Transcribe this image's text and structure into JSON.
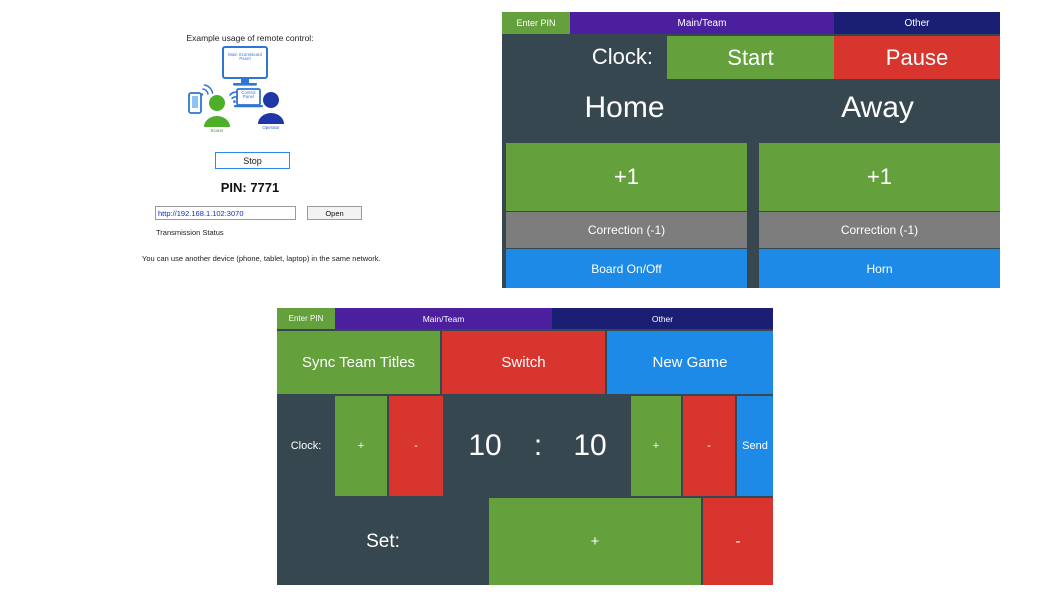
{
  "left_panel": {
    "caption": "Example usage of remote control:",
    "diagram": {
      "main_panel_label": "Main ScoreBoard Panel",
      "control_panel_label": "Control Panel",
      "scorer_label": "Scorer",
      "operator_label": "Operator"
    },
    "stop_button": "Stop",
    "pin_text": "PIN: 7771",
    "url_value": "http://192.168.1.102:3070",
    "url_placeholder": "http://",
    "open_button": "Open",
    "transmission_status": "Transmission Status",
    "note": "You can use another device (phone, tablet, laptop) in the same network."
  },
  "panel_main": {
    "tabs": [
      {
        "label": "Enter PIN",
        "color": "#64a03c"
      },
      {
        "label": "Main/Team",
        "color": "#4b1f9e"
      },
      {
        "label": "Other",
        "color": "#1b1f74"
      }
    ],
    "clock_label": "Clock:",
    "start_button": "Start",
    "pause_button": "Pause",
    "home_label": "Home",
    "away_label": "Away",
    "home_plus": "+1",
    "away_plus": "+1",
    "home_correction": "Correction (-1)",
    "away_correction": "Correction (-1)",
    "board_on_off": "Board On/Off",
    "horn": "Horn"
  },
  "panel_other": {
    "tabs": [
      {
        "label": "Enter PIN",
        "color": "#64a03c"
      },
      {
        "label": "Main/Team",
        "color": "#4b1f9e"
      },
      {
        "label": "Other",
        "color": "#1b1f74"
      }
    ],
    "sync_team_titles": "Sync Team Titles",
    "switch_button": "Switch",
    "new_game_button": "New Game",
    "clock_label": "Clock:",
    "minutes_plus": "+",
    "minutes_minus": "-",
    "minutes_value": "10",
    "colon": ":",
    "seconds_value": "10",
    "seconds_plus": "+",
    "seconds_minus": "-",
    "send_button": "Send",
    "set_label": "Set:",
    "set_plus": "+",
    "set_minus": "-"
  },
  "colors": {
    "panel_background": "#37474f",
    "green": "#64a03c",
    "red": "#d8352e",
    "blue": "#1e8ae8",
    "grey": "#7d7d7d",
    "purple": "#4b1f9e",
    "navy": "#1b1f74",
    "diagram_blue": "#2e75d4",
    "scorer_green": "#4caf27"
  }
}
